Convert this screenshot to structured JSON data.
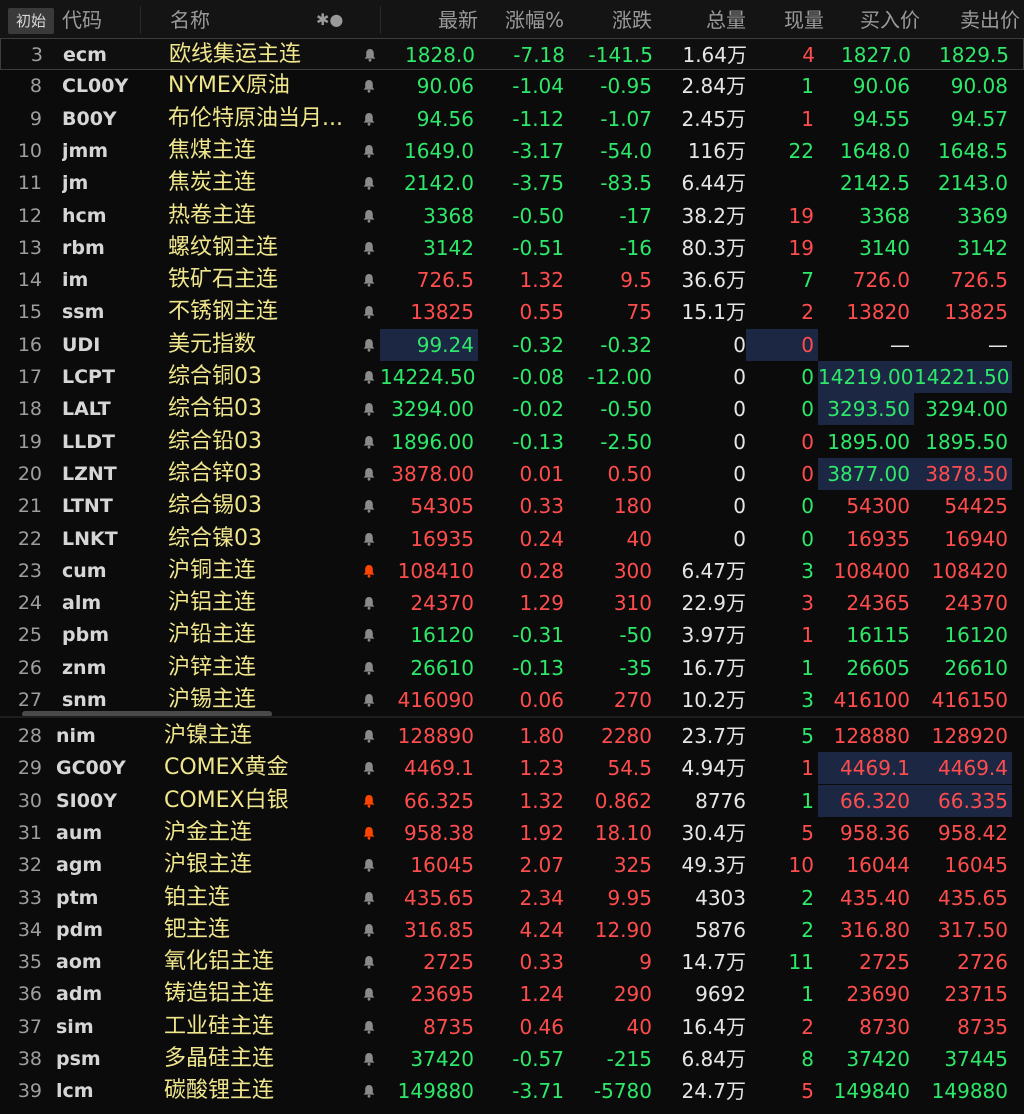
{
  "header": {
    "badge": "初始",
    "code": "代码",
    "name": "名称",
    "bell": "✱●",
    "last": "最新",
    "change_pct": "涨幅%",
    "change": "涨跌",
    "volume": "总量",
    "cur_vol": "现量",
    "bid": "买入价",
    "ask": "卖出价"
  },
  "colors": {
    "up": "#ff4d4d",
    "down": "#2ee86a",
    "name": "#f0e68c",
    "highlight_bg": "#1c2744",
    "bell_active": "#ff4500"
  },
  "rows": [
    {
      "idx": "3",
      "code": "ecm",
      "name": "欧线集运主连",
      "last": "1828.0",
      "pct": "-7.18",
      "chg": "-141.5",
      "vol": "1.64万",
      "cur": "4",
      "bid": "1827.0",
      "ask": "1829.5",
      "dir": "down",
      "cur_c": "red",
      "bid_c": "green",
      "ask_c": "green",
      "bell": "normal",
      "sel": true
    },
    {
      "idx": "8",
      "code": "CL00Y",
      "name": "NYMEX原油",
      "last": "90.06",
      "pct": "-1.04",
      "chg": "-0.95",
      "vol": "2.84万",
      "cur": "1",
      "bid": "90.06",
      "ask": "90.08",
      "dir": "down",
      "cur_c": "green",
      "bid_c": "green",
      "ask_c": "green",
      "bell": "normal"
    },
    {
      "idx": "9",
      "code": "B00Y",
      "name": "布伦特原油当月...",
      "last": "94.56",
      "pct": "-1.12",
      "chg": "-1.07",
      "vol": "2.45万",
      "cur": "1",
      "bid": "94.55",
      "ask": "94.57",
      "dir": "down",
      "cur_c": "red",
      "bid_c": "green",
      "ask_c": "green",
      "bell": "normal"
    },
    {
      "idx": "10",
      "code": "jmm",
      "name": "焦煤主连",
      "last": "1649.0",
      "pct": "-3.17",
      "chg": "-54.0",
      "vol": "116万",
      "cur": "22",
      "bid": "1648.0",
      "ask": "1648.5",
      "dir": "down",
      "cur_c": "green",
      "bid_c": "green",
      "ask_c": "green",
      "bell": "normal"
    },
    {
      "idx": "11",
      "code": "jm",
      "name": "焦炭主连",
      "last": "2142.0",
      "pct": "-3.75",
      "chg": "-83.5",
      "vol": "6.44万",
      "cur": "",
      "bid": "2142.5",
      "ask": "2143.0",
      "dir": "down",
      "cur_c": "green",
      "bid_c": "green",
      "ask_c": "green",
      "bell": "normal"
    },
    {
      "idx": "12",
      "code": "hcm",
      "name": "热卷主连",
      "last": "3368",
      "pct": "-0.50",
      "chg": "-17",
      "vol": "38.2万",
      "cur": "19",
      "bid": "3368",
      "ask": "3369",
      "dir": "down",
      "cur_c": "red",
      "bid_c": "green",
      "ask_c": "green",
      "bell": "normal"
    },
    {
      "idx": "13",
      "code": "rbm",
      "name": "螺纹钢主连",
      "last": "3142",
      "pct": "-0.51",
      "chg": "-16",
      "vol": "80.3万",
      "cur": "19",
      "bid": "3140",
      "ask": "3142",
      "dir": "down",
      "cur_c": "red",
      "bid_c": "green",
      "ask_c": "green",
      "bell": "normal"
    },
    {
      "idx": "14",
      "code": "im",
      "name": "铁矿石主连",
      "last": "726.5",
      "pct": "1.32",
      "chg": "9.5",
      "vol": "36.6万",
      "cur": "7",
      "bid": "726.0",
      "ask": "726.5",
      "dir": "up",
      "cur_c": "green",
      "bid_c": "red",
      "ask_c": "red",
      "bell": "normal"
    },
    {
      "idx": "15",
      "code": "ssm",
      "name": "不锈钢主连",
      "last": "13825",
      "pct": "0.55",
      "chg": "75",
      "vol": "15.1万",
      "cur": "2",
      "bid": "13820",
      "ask": "13825",
      "dir": "up",
      "cur_c": "red",
      "bid_c": "red",
      "ask_c": "red",
      "bell": "normal"
    },
    {
      "idx": "16",
      "code": "UDI",
      "name": "美元指数",
      "last": "99.24",
      "pct": "-0.32",
      "chg": "-0.32",
      "vol": "0",
      "cur": "0",
      "bid": "—",
      "ask": "—",
      "dir": "down",
      "cur_c": "red",
      "bid_c": "white",
      "ask_c": "white",
      "bell": "normal",
      "hl_last": true,
      "hl_cur": true
    },
    {
      "idx": "17",
      "code": "LCPT",
      "name": "综合铜03",
      "last": "14224.50",
      "pct": "-0.08",
      "chg": "-12.00",
      "vol": "0",
      "cur": "0",
      "bid": "14219.00",
      "ask": "14221.50",
      "dir": "down",
      "cur_c": "green",
      "bid_c": "green",
      "ask_c": "green",
      "bell": "normal",
      "hl_bid": true,
      "hl_ask": true
    },
    {
      "idx": "18",
      "code": "LALT",
      "name": "综合铝03",
      "last": "3294.00",
      "pct": "-0.02",
      "chg": "-0.50",
      "vol": "0",
      "cur": "0",
      "bid": "3293.50",
      "ask": "3294.00",
      "dir": "down",
      "cur_c": "green",
      "bid_c": "green",
      "ask_c": "green",
      "bell": "normal",
      "hl_bid": true
    },
    {
      "idx": "19",
      "code": "LLDT",
      "name": "综合铅03",
      "last": "1896.00",
      "pct": "-0.13",
      "chg": "-2.50",
      "vol": "0",
      "cur": "0",
      "bid": "1895.00",
      "ask": "1895.50",
      "dir": "down",
      "cur_c": "red",
      "bid_c": "green",
      "ask_c": "green",
      "bell": "normal"
    },
    {
      "idx": "20",
      "code": "LZNT",
      "name": "综合锌03",
      "last": "3878.00",
      "pct": "0.01",
      "chg": "0.50",
      "vol": "0",
      "cur": "0",
      "bid": "3877.00",
      "ask": "3878.50",
      "dir": "up",
      "cur_c": "red",
      "bid_c": "green",
      "ask_c": "red",
      "bell": "normal",
      "hl_bid": true,
      "hl_ask": true
    },
    {
      "idx": "21",
      "code": "LTNT",
      "name": "综合锡03",
      "last": "54305",
      "pct": "0.33",
      "chg": "180",
      "vol": "0",
      "cur": "0",
      "bid": "54300",
      "ask": "54425",
      "dir": "up",
      "cur_c": "green",
      "bid_c": "red",
      "ask_c": "red",
      "bell": "normal"
    },
    {
      "idx": "22",
      "code": "LNKT",
      "name": "综合镍03",
      "last": "16935",
      "pct": "0.24",
      "chg": "40",
      "vol": "0",
      "cur": "0",
      "bid": "16935",
      "ask": "16940",
      "dir": "up",
      "cur_c": "green",
      "bid_c": "red",
      "ask_c": "red",
      "bell": "normal"
    },
    {
      "idx": "23",
      "code": "cum",
      "name": "沪铜主连",
      "last": "108410",
      "pct": "0.28",
      "chg": "300",
      "vol": "6.47万",
      "cur": "3",
      "bid": "108400",
      "ask": "108420",
      "dir": "up",
      "cur_c": "green",
      "bid_c": "red",
      "ask_c": "red",
      "bell": "active"
    },
    {
      "idx": "24",
      "code": "alm",
      "name": "沪铝主连",
      "last": "24370",
      "pct": "1.29",
      "chg": "310",
      "vol": "22.9万",
      "cur": "3",
      "bid": "24365",
      "ask": "24370",
      "dir": "up",
      "cur_c": "red",
      "bid_c": "red",
      "ask_c": "red",
      "bell": "normal"
    },
    {
      "idx": "25",
      "code": "pbm",
      "name": "沪铅主连",
      "last": "16120",
      "pct": "-0.31",
      "chg": "-50",
      "vol": "3.97万",
      "cur": "1",
      "bid": "16115",
      "ask": "16120",
      "dir": "down",
      "cur_c": "red",
      "bid_c": "green",
      "ask_c": "green",
      "bell": "normal"
    },
    {
      "idx": "26",
      "code": "znm",
      "name": "沪锌主连",
      "last": "26610",
      "pct": "-0.13",
      "chg": "-35",
      "vol": "16.7万",
      "cur": "1",
      "bid": "26605",
      "ask": "26610",
      "dir": "down",
      "cur_c": "green",
      "bid_c": "green",
      "ask_c": "green",
      "bell": "normal"
    },
    {
      "idx": "27",
      "code": "snm",
      "name": "沪锡主连",
      "last": "416090",
      "pct": "0.06",
      "chg": "270",
      "vol": "10.2万",
      "cur": "3",
      "bid": "416100",
      "ask": "416150",
      "dir": "up",
      "cur_c": "green",
      "bid_c": "red",
      "ask_c": "red",
      "bell": "normal"
    }
  ],
  "rows2": [
    {
      "idx": "28",
      "code": "nim",
      "name": "沪镍主连",
      "last": "128890",
      "pct": "1.80",
      "chg": "2280",
      "vol": "23.7万",
      "cur": "5",
      "bid": "128880",
      "ask": "128920",
      "dir": "up",
      "cur_c": "green",
      "bid_c": "red",
      "ask_c": "red",
      "bell": "normal"
    },
    {
      "idx": "29",
      "code": "GC00Y",
      "name": "COMEX黄金",
      "last": "4469.1",
      "pct": "1.23",
      "chg": "54.5",
      "vol": "4.94万",
      "cur": "1",
      "bid": "4469.1",
      "ask": "4469.4",
      "dir": "up",
      "cur_c": "red",
      "bid_c": "red",
      "ask_c": "red",
      "bell": "normal",
      "hl_bid": true,
      "hl_ask": true
    },
    {
      "idx": "30",
      "code": "SI00Y",
      "name": "COMEX白银",
      "last": "66.325",
      "pct": "1.32",
      "chg": "0.862",
      "vol": "8776",
      "cur": "1",
      "bid": "66.320",
      "ask": "66.335",
      "dir": "up",
      "cur_c": "green",
      "bid_c": "red",
      "ask_c": "red",
      "bell": "active",
      "hl_bid": true,
      "hl_ask": true
    },
    {
      "idx": "31",
      "code": "aum",
      "name": "沪金主连",
      "last": "958.38",
      "pct": "1.92",
      "chg": "18.10",
      "vol": "30.4万",
      "cur": "5",
      "bid": "958.36",
      "ask": "958.42",
      "dir": "up",
      "cur_c": "red",
      "bid_c": "red",
      "ask_c": "red",
      "bell": "active"
    },
    {
      "idx": "32",
      "code": "agm",
      "name": "沪银主连",
      "last": "16045",
      "pct": "2.07",
      "chg": "325",
      "vol": "49.3万",
      "cur": "10",
      "bid": "16044",
      "ask": "16045",
      "dir": "up",
      "cur_c": "red",
      "bid_c": "red",
      "ask_c": "red",
      "bell": "normal"
    },
    {
      "idx": "33",
      "code": "ptm",
      "name": "铂主连",
      "last": "435.65",
      "pct": "2.34",
      "chg": "9.95",
      "vol": "4303",
      "cur": "2",
      "bid": "435.40",
      "ask": "435.65",
      "dir": "up",
      "cur_c": "green",
      "bid_c": "red",
      "ask_c": "red",
      "bell": "normal"
    },
    {
      "idx": "34",
      "code": "pdm",
      "name": "钯主连",
      "last": "316.85",
      "pct": "4.24",
      "chg": "12.90",
      "vol": "5876",
      "cur": "2",
      "bid": "316.80",
      "ask": "317.50",
      "dir": "up",
      "cur_c": "green",
      "bid_c": "red",
      "ask_c": "red",
      "bell": "normal"
    },
    {
      "idx": "35",
      "code": "aom",
      "name": "氧化铝主连",
      "last": "2725",
      "pct": "0.33",
      "chg": "9",
      "vol": "14.7万",
      "cur": "11",
      "bid": "2725",
      "ask": "2726",
      "dir": "up",
      "cur_c": "green",
      "bid_c": "red",
      "ask_c": "red",
      "bell": "normal"
    },
    {
      "idx": "36",
      "code": "adm",
      "name": "铸造铝主连",
      "last": "23695",
      "pct": "1.24",
      "chg": "290",
      "vol": "9692",
      "cur": "1",
      "bid": "23690",
      "ask": "23715",
      "dir": "up",
      "cur_c": "green",
      "bid_c": "red",
      "ask_c": "red",
      "bell": "normal"
    },
    {
      "idx": "37",
      "code": "sim",
      "name": "工业硅主连",
      "last": "8735",
      "pct": "0.46",
      "chg": "40",
      "vol": "16.4万",
      "cur": "2",
      "bid": "8730",
      "ask": "8735",
      "dir": "up",
      "cur_c": "red",
      "bid_c": "red",
      "ask_c": "red",
      "bell": "normal"
    },
    {
      "idx": "38",
      "code": "psm",
      "name": "多晶硅主连",
      "last": "37420",
      "pct": "-0.57",
      "chg": "-215",
      "vol": "6.84万",
      "cur": "8",
      "bid": "37420",
      "ask": "37445",
      "dir": "down",
      "cur_c": "green",
      "bid_c": "green",
      "ask_c": "green",
      "bell": "normal"
    },
    {
      "idx": "39",
      "code": "lcm",
      "name": "碳酸锂主连",
      "last": "149880",
      "pct": "-3.71",
      "chg": "-5780",
      "vol": "24.7万",
      "cur": "5",
      "bid": "149840",
      "ask": "149880",
      "dir": "down",
      "cur_c": "red",
      "bid_c": "green",
      "ask_c": "green",
      "bell": "normal"
    }
  ]
}
